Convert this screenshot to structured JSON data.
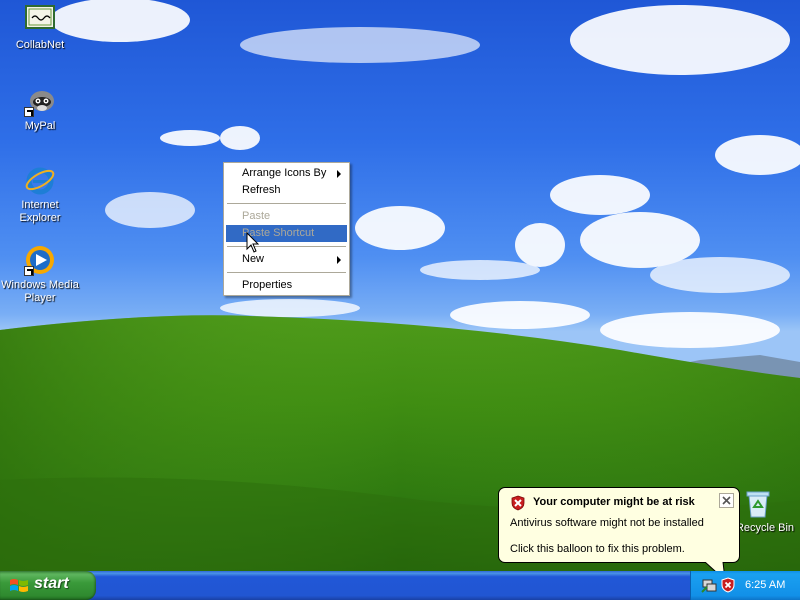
{
  "desktop": {
    "icons": [
      {
        "label": "CollabNet",
        "icon": "certificate-icon"
      },
      {
        "label": "MyPal",
        "icon": "raccoon-icon"
      },
      {
        "label": "Internet Explorer",
        "icon": "internet-explorer-icon"
      },
      {
        "label": "Windows Media Player",
        "icon": "media-player-icon"
      },
      {
        "label": "Recycle Bin",
        "icon": "recycle-bin-icon"
      }
    ]
  },
  "context_menu": {
    "items": [
      {
        "label": "Arrange Icons By",
        "submenu": true,
        "state": "enabled"
      },
      {
        "label": "Refresh",
        "submenu": false,
        "state": "enabled"
      },
      {
        "label": "Paste",
        "submenu": false,
        "state": "disabled"
      },
      {
        "label": "Paste Shortcut",
        "submenu": false,
        "state": "disabled-highlighted"
      },
      {
        "label": "New",
        "submenu": true,
        "state": "enabled"
      },
      {
        "label": "Properties",
        "submenu": false,
        "state": "enabled"
      }
    ]
  },
  "balloon": {
    "title": "Your computer might be at risk",
    "line1": "Antivirus software might not be installed",
    "line2": "Click this balloon to fix this problem.",
    "icon": "security-shield-icon"
  },
  "taskbar": {
    "start_label": "start",
    "clock": "6:25 AM",
    "tray_icons": [
      "network-icon",
      "security-alert-icon"
    ]
  },
  "colors": {
    "taskbar_blue": "#245edb",
    "start_green": "#3c9a3c",
    "tray_blue": "#1290e8",
    "highlight": "#316ac5",
    "balloon_bg": "#ffffe1"
  }
}
